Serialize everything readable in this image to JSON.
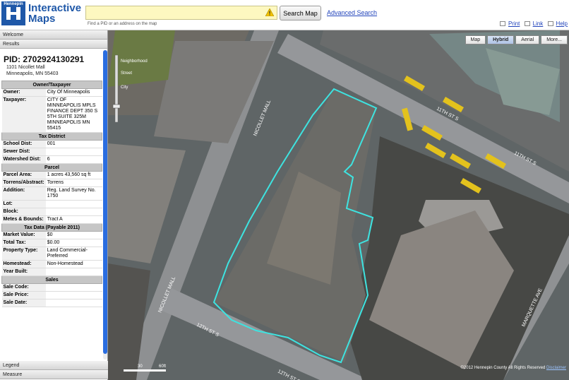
{
  "header": {
    "logo_text": "Hennepin",
    "brand_line1": "Interactive",
    "brand_line2": "Maps",
    "search_placeholder": "",
    "search_hint": "Find a PID or an address on the map",
    "search_button": "Search Map",
    "advanced_search": "Advanced Search",
    "print": "Print",
    "link": "Link",
    "help": "Help"
  },
  "panel": {
    "welcome": "Welcome",
    "results": "Results",
    "legend": "Legend",
    "measure": "Measure",
    "pid": "PID: 2702924130291",
    "address_line1": "1101 Nicollet Mall",
    "address_line2": "Minneapolis, MN 55403",
    "sections": [
      {
        "title": "Owner/Taxpayer",
        "rows": [
          {
            "k": "Owner:",
            "v": "City Of Minneapolis"
          },
          {
            "k": "Taxpayer:",
            "v": "CITY OF MINNEAPOLIS MPLS FINANCE DEPT 350 S 5TH SUITE 325M MINNEAPOLIS MN 55415"
          }
        ]
      },
      {
        "title": "Tax District",
        "rows": [
          {
            "k": "School Dist:",
            "v": "001"
          },
          {
            "k": "Sewer Dist:",
            "v": ""
          },
          {
            "k": "Watershed Dist:",
            "v": "6"
          }
        ]
      },
      {
        "title": "Parcel",
        "rows": [
          {
            "k": "Parcel Area:",
            "v": "1 acres 43,560 sq ft"
          },
          {
            "k": "Torrens/Abstract:",
            "v": "Torrens"
          },
          {
            "k": "Addition:",
            "v": "Reg. Land Survey No. 1750"
          },
          {
            "k": "Lot:",
            "v": ""
          },
          {
            "k": "Block:",
            "v": ""
          },
          {
            "k": "Metes & Bounds:",
            "v": "Tract A"
          }
        ]
      },
      {
        "title": "Tax Data (Payable 2011)",
        "rows": [
          {
            "k": "Market Value:",
            "v": "$0"
          },
          {
            "k": "Total Tax:",
            "v": "$0.00"
          },
          {
            "k": "Property Type:",
            "v": "Land Commercial-Preferred"
          },
          {
            "k": "Homestead:",
            "v": "Non-Homestead"
          },
          {
            "k": "Year Built:",
            "v": ""
          }
        ]
      },
      {
        "title": "Sales",
        "rows": [
          {
            "k": "Sale Code:",
            "v": ""
          },
          {
            "k": "Sale Price:",
            "v": ""
          },
          {
            "k": "Sale Date:",
            "v": ""
          }
        ]
      }
    ]
  },
  "map": {
    "buttons": [
      "Map",
      "Hybrid",
      "Aerial",
      "More..."
    ],
    "active": "Hybrid",
    "labels": {
      "nicollet1": "NICOLLET MALL",
      "nicollet2": "NICOLLET MALL",
      "st11a": "11TH ST S",
      "st11b": "11TH ST S",
      "st12a": "12TH ST S",
      "st12b": "12TH ST S",
      "marquette": "MARQUETTE AVE",
      "zoom_neigh": "Neighborhood",
      "zoom_street": "Street",
      "zoom_city": "City"
    },
    "copyright": "©2012 Hennepin County",
    "rights": "All Rights Reserved",
    "disclaimer": "Disclaimer",
    "scale": [
      "30",
      "60ft"
    ]
  },
  "colors": {
    "parcel": "#3ee3e0",
    "accent": "#1f58a8"
  }
}
